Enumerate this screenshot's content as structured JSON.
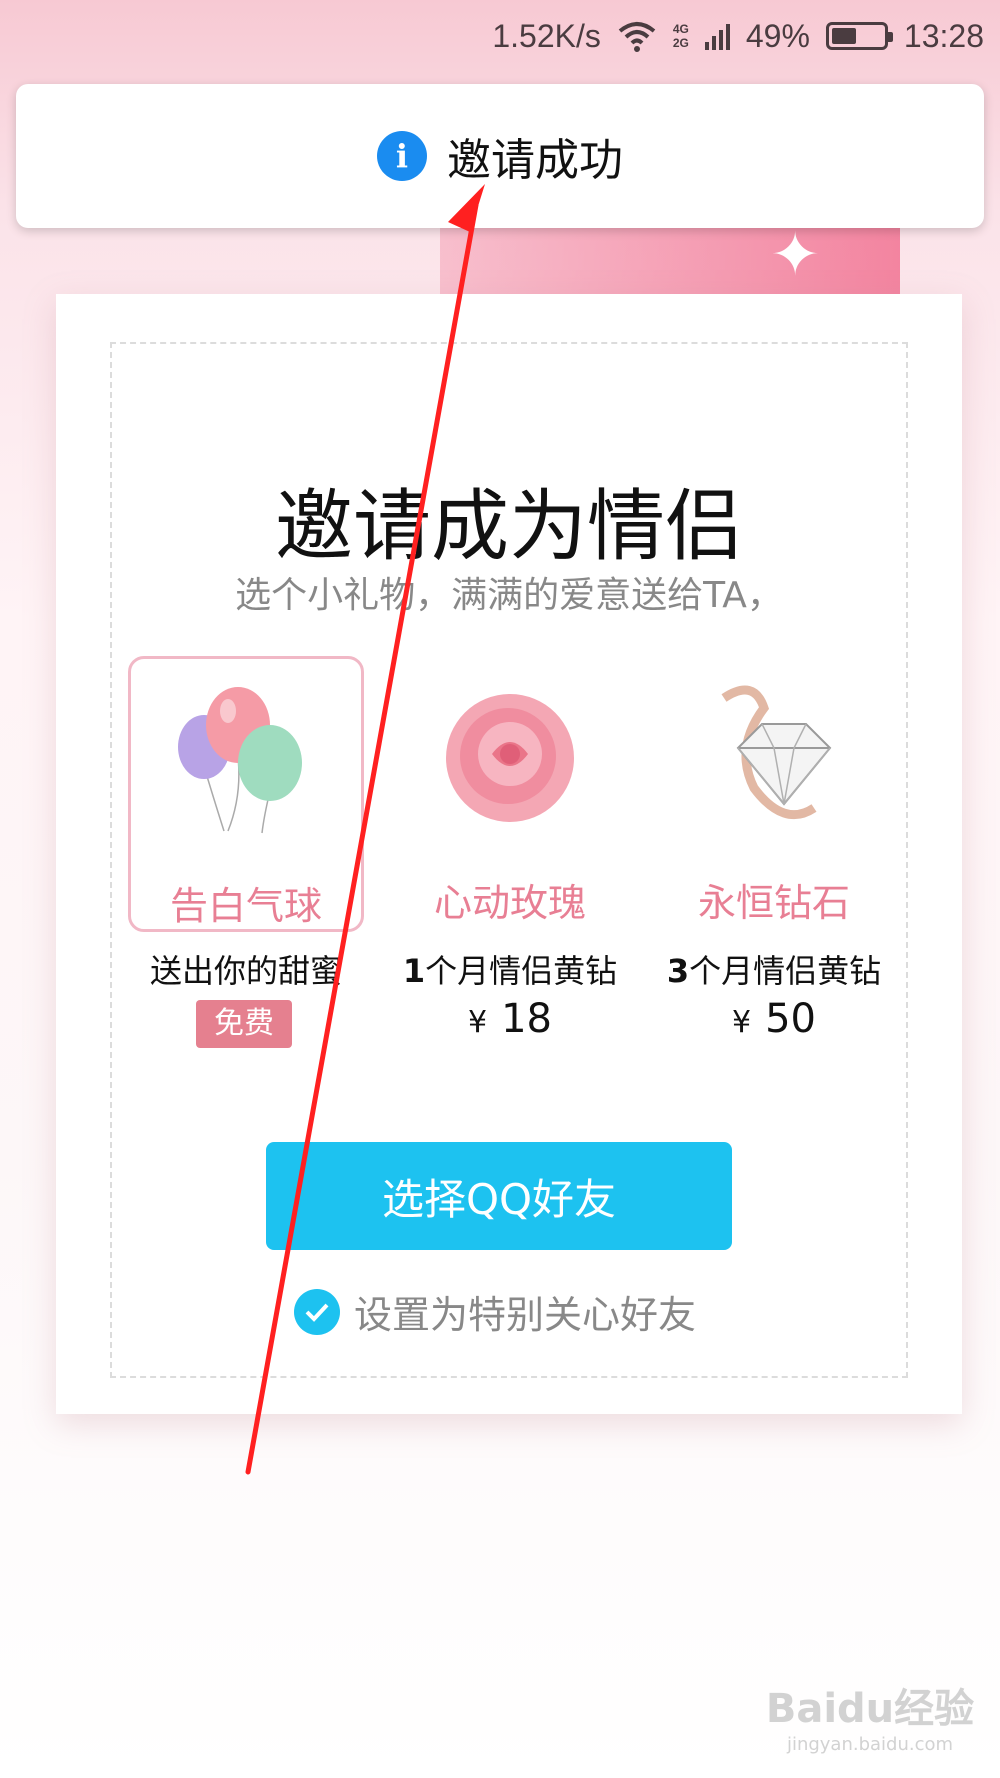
{
  "status_bar": {
    "speed": "1.52K/s",
    "network_top": "4G",
    "network_bottom": "2G",
    "battery": "49%",
    "battery_level": 0.49,
    "time": "13:28"
  },
  "toast": {
    "icon": "info-icon",
    "text": "邀请成功"
  },
  "card": {
    "title": "邀请成为情侣",
    "subtitle": "选个小礼物，满满的爱意送给TA，"
  },
  "gifts": [
    {
      "name": "告白气球",
      "desc": "送出你的甜蜜",
      "badge": "免费",
      "icon": "balloons-icon",
      "selected": true
    },
    {
      "name": "心动玫瑰",
      "desc_num": "1",
      "desc_text": "个月情侣黄钻",
      "currency": "¥",
      "price": "18",
      "icon": "rose-icon"
    },
    {
      "name": "永恒钻石",
      "desc_num": "3",
      "desc_text": "个月情侣黄钻",
      "currency": "¥",
      "price": "50",
      "icon": "diamond-icon"
    }
  ],
  "cta": {
    "label": "选择QQ好友"
  },
  "checkbox": {
    "label": "设置为特别关心好友",
    "checked": true
  },
  "colors": {
    "accent": "#1dc2f0",
    "pink": "#e87f94",
    "badge": "#e5808f",
    "info": "#1a8cf0",
    "annotation": "#ff2020"
  },
  "watermark": {
    "logo": "Baidu经验",
    "url": "jingyan.baidu.com"
  }
}
